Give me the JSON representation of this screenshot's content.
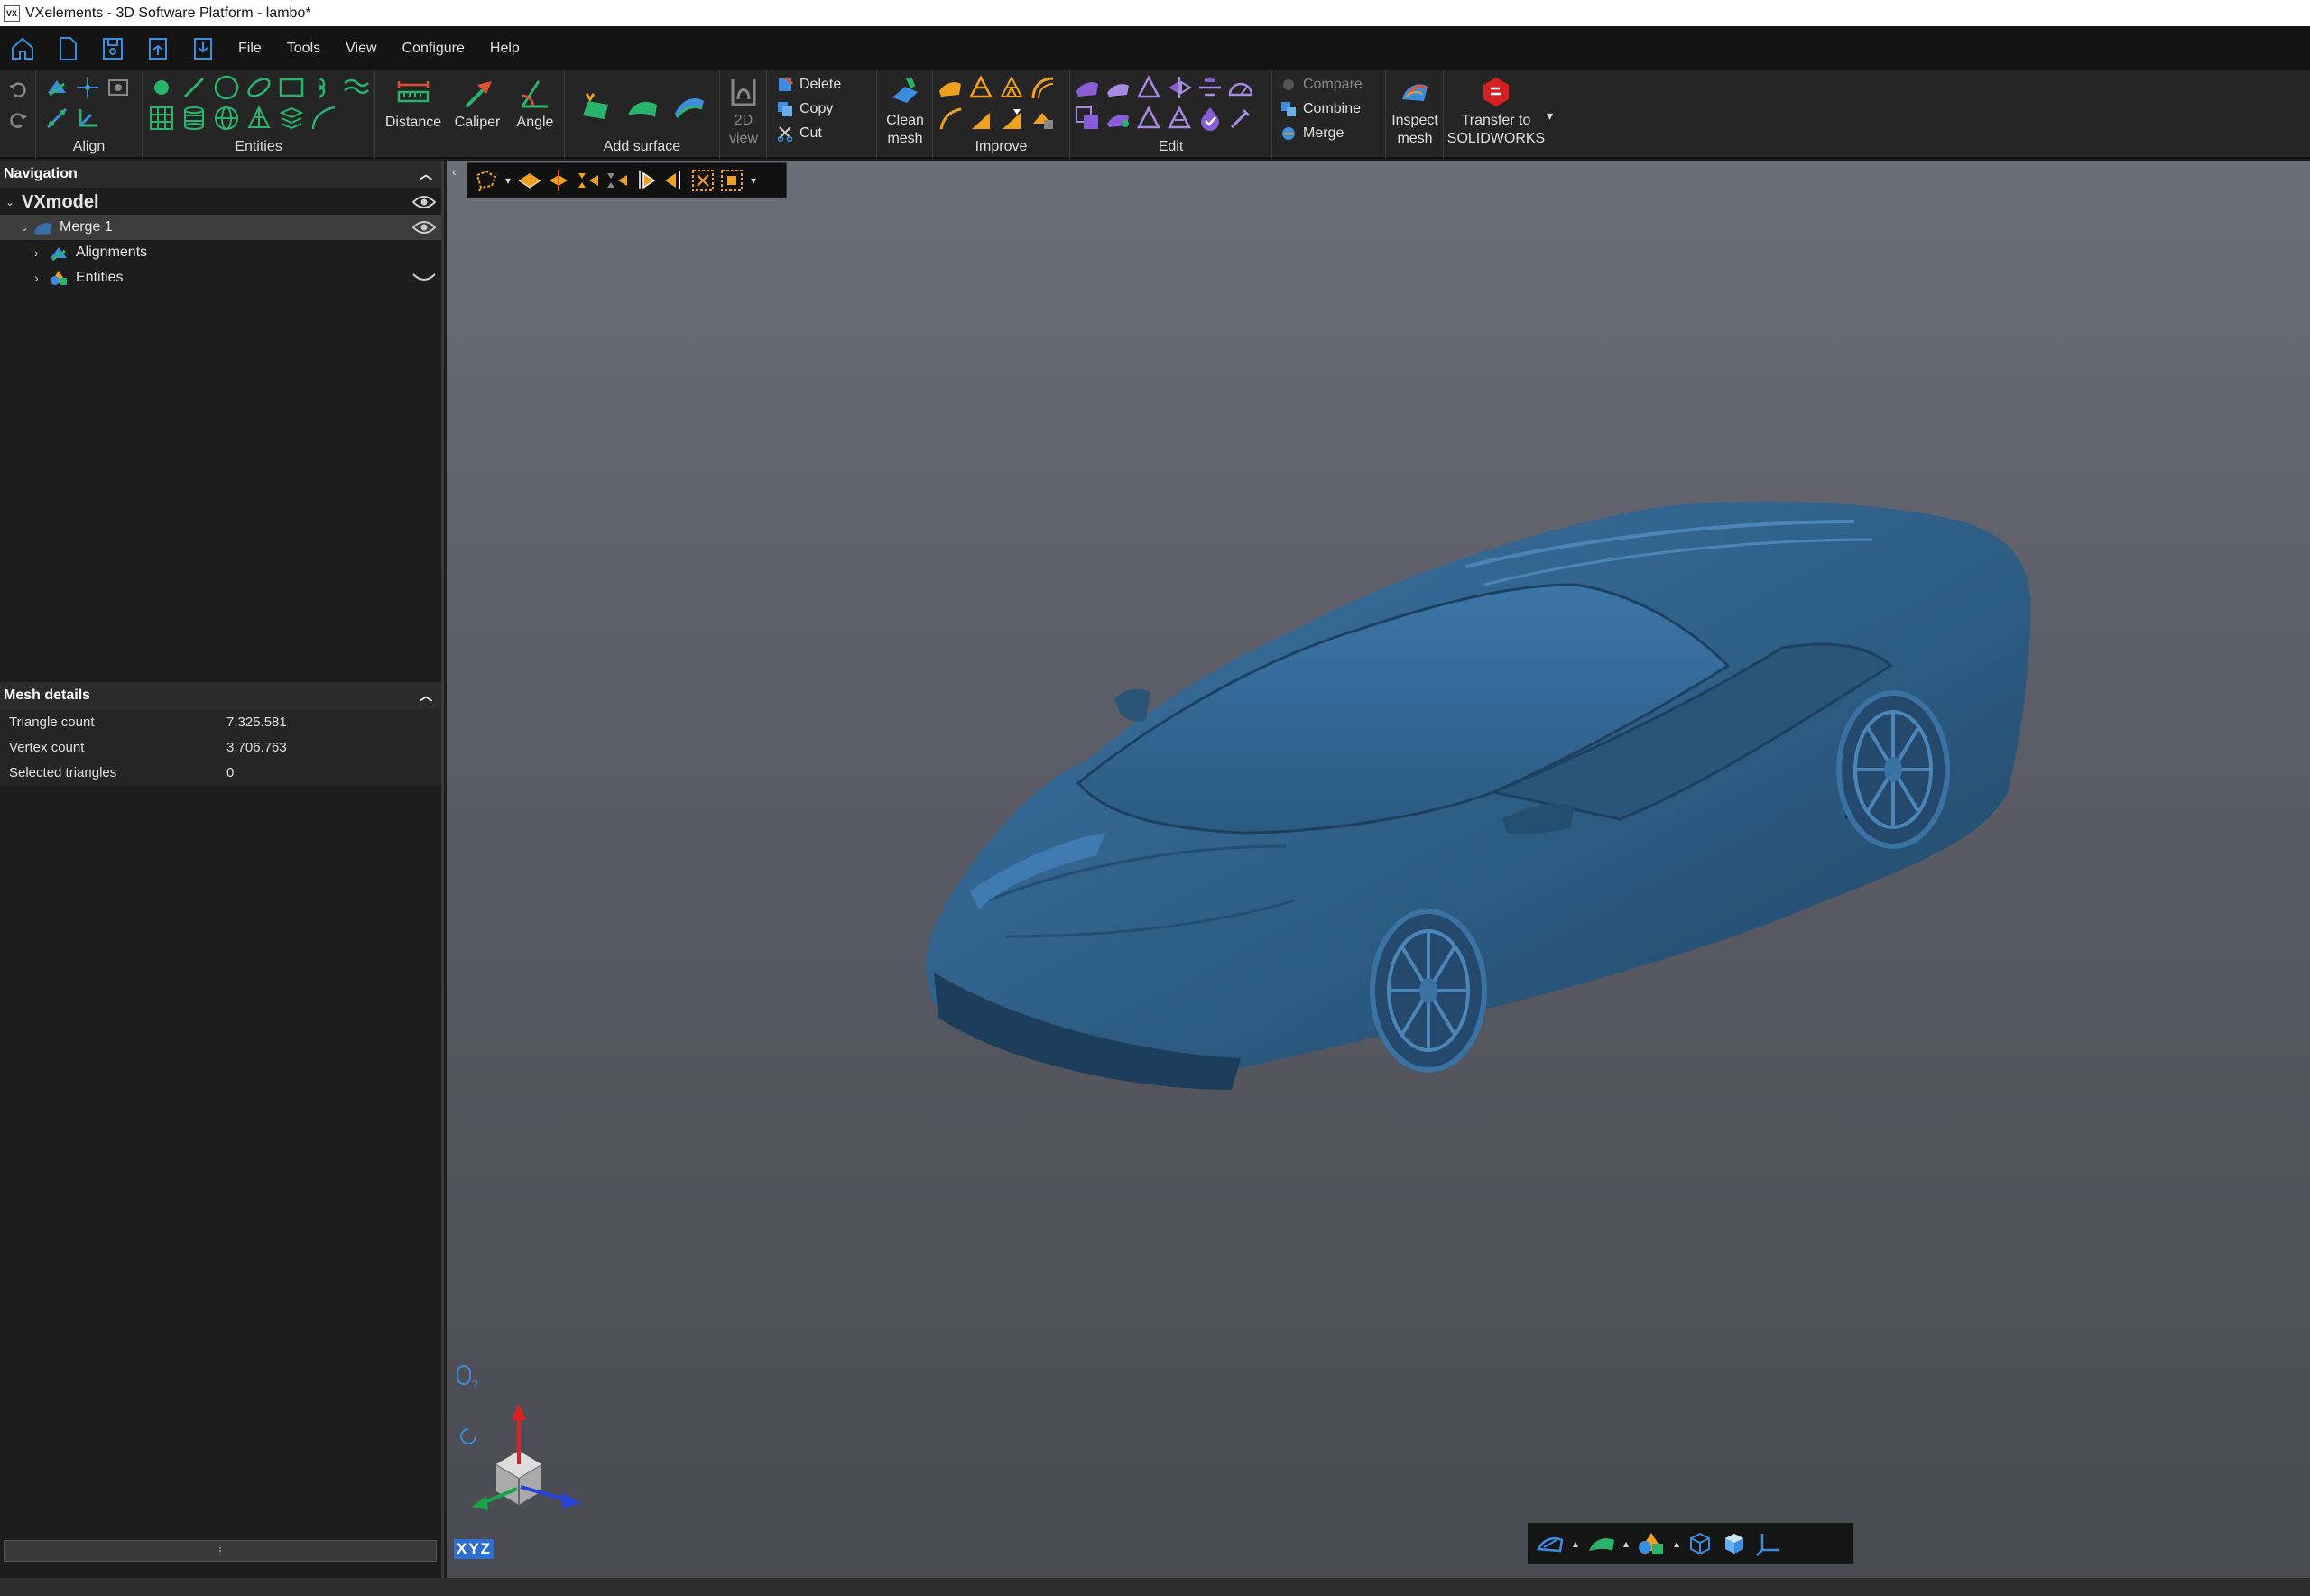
{
  "window": {
    "title": "VXelements - 3D Software Platform - lambo*",
    "logo": "VX"
  },
  "menubar": {
    "items": [
      "File",
      "Tools",
      "View",
      "Configure",
      "Help"
    ]
  },
  "ribbon": {
    "groups": {
      "align": "Align",
      "entities": "Entities",
      "add_surface": "Add surface",
      "improve": "Improve",
      "edit": "Edit"
    },
    "buttons": {
      "distance": "Distance",
      "caliper": "Caliper",
      "angle": "Angle",
      "view2d_line1": "2D",
      "view2d_line2": "view",
      "delete": "Delete",
      "copy": "Copy",
      "cut": "Cut",
      "clean_line1": "Clean",
      "clean_line2": "mesh",
      "compare": "Compare",
      "combine": "Combine",
      "merge": "Merge",
      "inspect_line1": "Inspect",
      "inspect_line2": "mesh",
      "transfer_line1": "Transfer to",
      "transfer_line2": "SOLIDWORKS"
    }
  },
  "navigation": {
    "title": "Navigation",
    "root": "VXmodel",
    "items": [
      {
        "label": "Merge 1"
      },
      {
        "label": "Alignments"
      },
      {
        "label": "Entities"
      }
    ]
  },
  "mesh_details": {
    "title": "Mesh details",
    "rows": [
      {
        "key": "Triangle count",
        "value": "7.325.581"
      },
      {
        "key": "Vertex count",
        "value": "3.706.763"
      },
      {
        "key": "Selected triangles",
        "value": "0"
      }
    ]
  },
  "viewport": {
    "axis_label": "XYZ",
    "model_color": "#2f5f87",
    "axis_colors": {
      "x": "#e02020",
      "y": "#16a34a",
      "z": "#2244dd"
    }
  },
  "colors": {
    "accent_green": "#29b36b",
    "accent_orange": "#f0a020",
    "accent_purple": "#8a5cd6",
    "accent_blue": "#3b8de0"
  }
}
